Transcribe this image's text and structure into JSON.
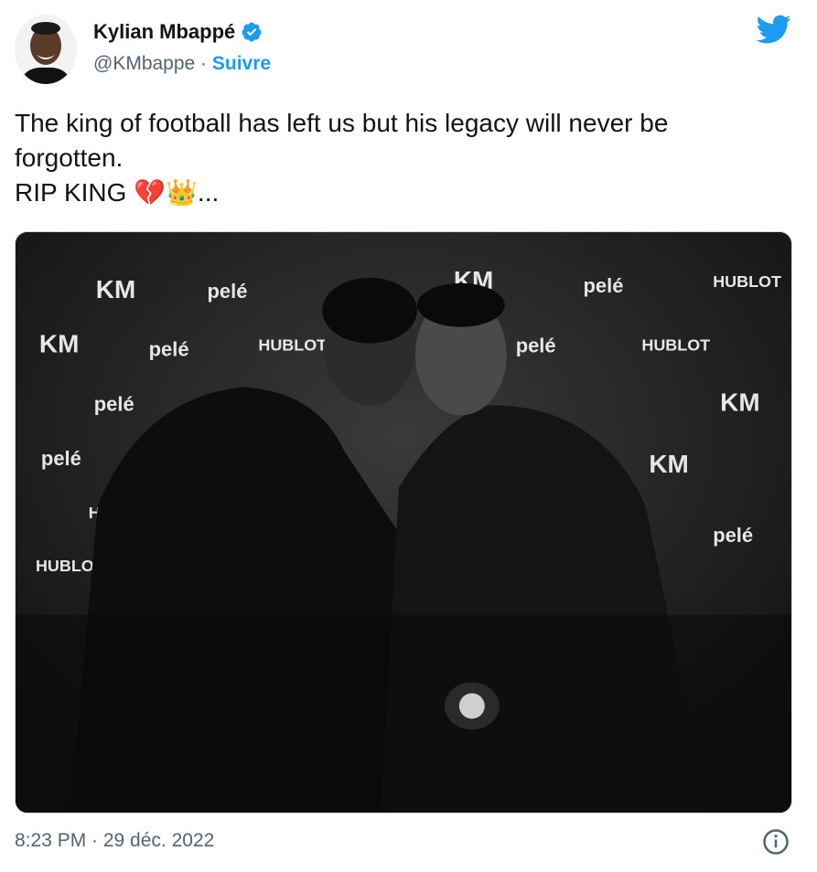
{
  "author": {
    "name": "Kylian Mbappé",
    "handle": "@KMbappe",
    "separator": " · ",
    "follow_label": "Suivre",
    "verified": true
  },
  "tweet": {
    "lines": [
      "The king of football has left us but his legacy will never be",
      "forgotten.",
      "RIP KING 💔👑..."
    ]
  },
  "photo": {
    "backdrop_logos": [
      "KM",
      "pelé",
      "HUBLOT"
    ]
  },
  "footer": {
    "timestamp": "8:23 PM · 29 déc. 2022"
  },
  "icons": {
    "verified": "verified-badge-icon",
    "brand": "twitter-bird-icon",
    "info": "info-icon"
  },
  "colors": {
    "accent": "#1d9bf0",
    "text": "#0f1419",
    "secondary": "#536471"
  }
}
